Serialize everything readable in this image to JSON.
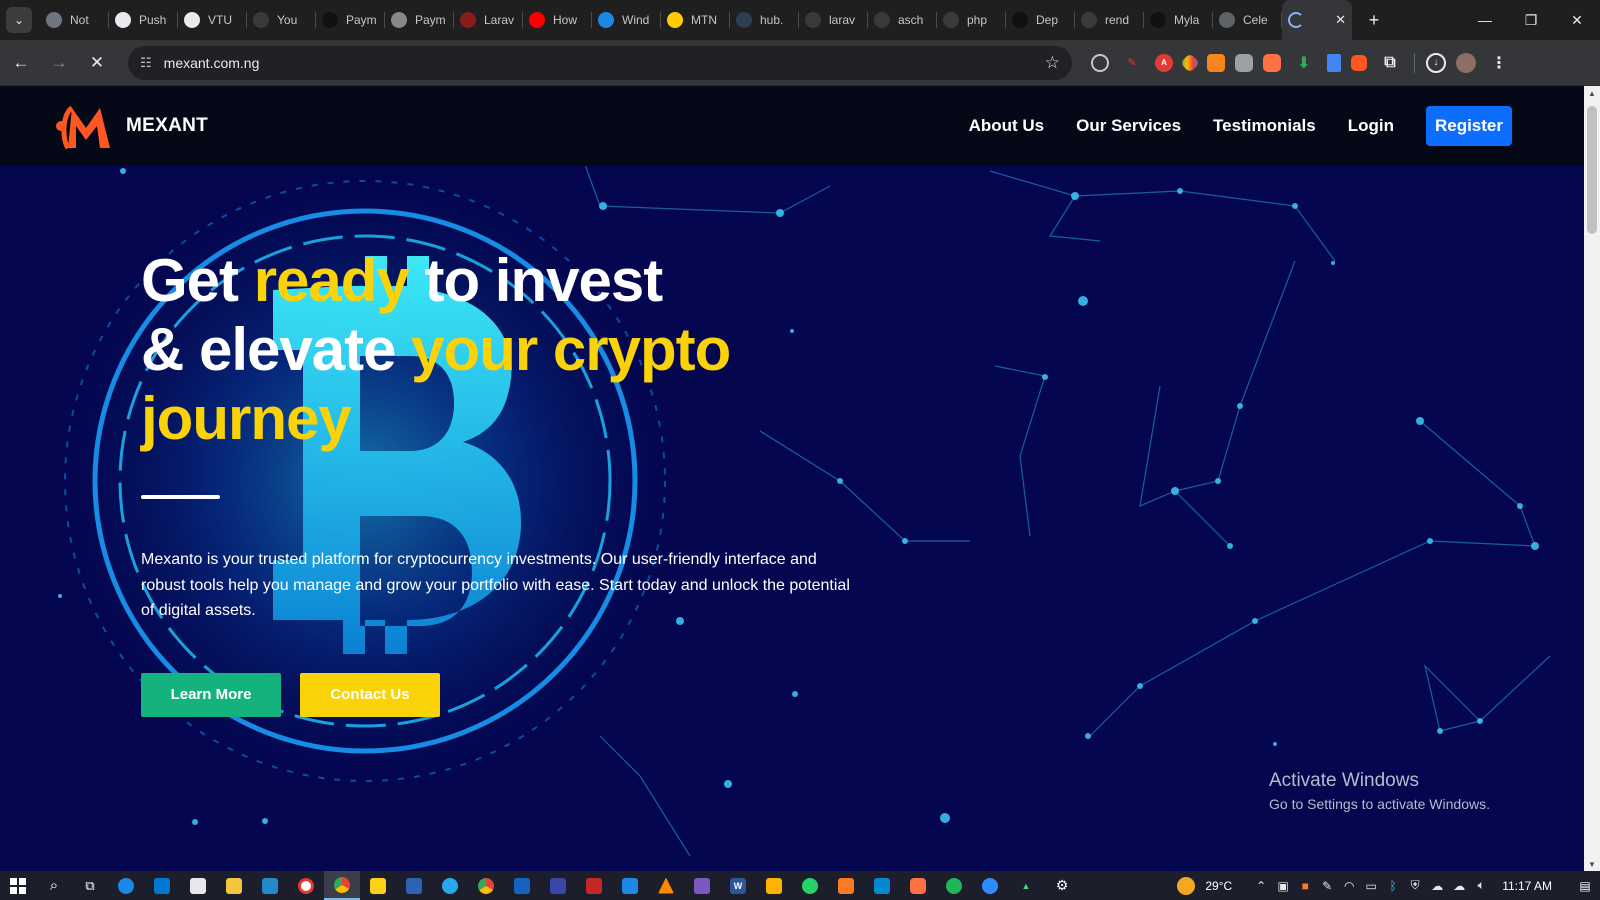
{
  "browser": {
    "tabs": [
      {
        "label": "Not",
        "icon": "github-icon",
        "color": "#6e7681"
      },
      {
        "label": "Push",
        "icon": "chatgpt-icon",
        "color": "#e8eaed"
      },
      {
        "label": "VTU",
        "icon": "chatgpt-icon",
        "color": "#e8eaed"
      },
      {
        "label": "You",
        "icon": "github-icon",
        "color": "#3a3a3a"
      },
      {
        "label": "Paym",
        "icon": "render-icon",
        "color": "#111111"
      },
      {
        "label": "Paym",
        "icon": "loading-icon",
        "color": "#888888"
      },
      {
        "label": "Larav",
        "icon": "laravel-icon",
        "color": "#8a1c1c"
      },
      {
        "label": "How",
        "icon": "youtube-icon",
        "color": "#ff0000"
      },
      {
        "label": "Wind",
        "icon": "edge-icon",
        "color": "#1e88e5"
      },
      {
        "label": "MTN",
        "icon": "mtn-icon",
        "color": "#ffcc00"
      },
      {
        "label": "hub.",
        "icon": "hub-icon",
        "color": "#2c3e50"
      },
      {
        "label": "larav",
        "icon": "github-icon",
        "color": "#3a3a3a"
      },
      {
        "label": "asch",
        "icon": "github-icon",
        "color": "#3a3a3a"
      },
      {
        "label": "php",
        "icon": "github-icon",
        "color": "#3a3a3a"
      },
      {
        "label": "Dep",
        "icon": "render-icon",
        "color": "#111111"
      },
      {
        "label": "rend",
        "icon": "github-icon",
        "color": "#3a3a3a"
      },
      {
        "label": "Myla",
        "icon": "render-icon",
        "color": "#111111"
      },
      {
        "label": "Cele",
        "icon": "globe-icon",
        "color": "#5f6368"
      }
    ],
    "active_tab_close": "✕",
    "new_tab": "+",
    "url": "mexant.com.ng",
    "window_controls": {
      "minimize": "—",
      "restore": "❐",
      "close": "✕"
    }
  },
  "site": {
    "brand": "MEXANT",
    "nav": {
      "about": "About Us",
      "services": "Our Services",
      "testimonials": "Testimonials",
      "login": "Login",
      "register": "Register"
    },
    "hero": {
      "line1_a": "Get ",
      "line1_b": "ready",
      "line1_c": " to invest",
      "line2_a": "& elevate ",
      "line2_b": "your crypto",
      "line3": "journey",
      "lead": "Mexanto is your trusted platform for cryptocurrency investments. Our user-friendly interface and robust tools help you manage and grow your portfolio with ease. Start today and unlock the potential of digital assets.",
      "learn_more": "Learn More",
      "contact_us": "Contact Us"
    },
    "colors": {
      "accent_yellow": "#fad208",
      "cta_green": "#14b37d",
      "register_blue": "#0d6efd",
      "bg": "#04064f"
    }
  },
  "watermark": {
    "title": "Activate Windows",
    "subtitle": "Go to Settings to activate Windows."
  },
  "taskbar": {
    "weather": "29°C",
    "time": "11:17 AM"
  }
}
